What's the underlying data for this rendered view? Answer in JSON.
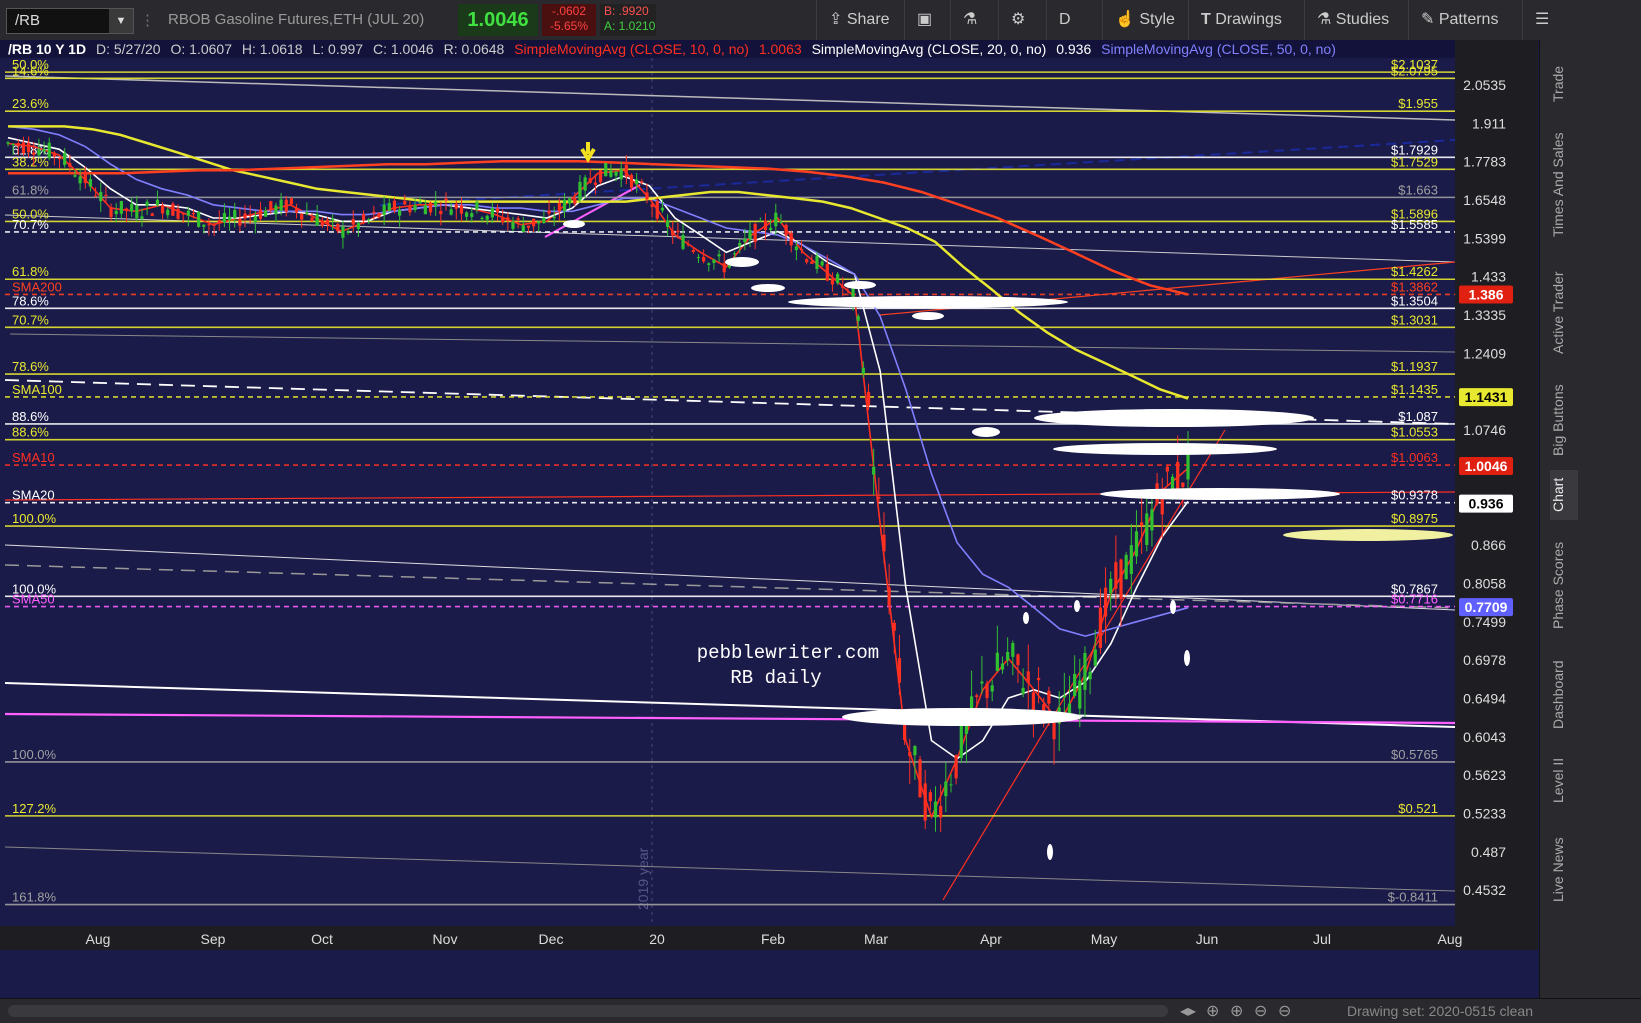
{
  "toolbar": {
    "symbol": "/RB",
    "description": "RBOB Gasoline Futures,ETH (JUL 20)",
    "last": "1.0046",
    "change": "-.0602",
    "change_pct": "-5.65%",
    "bid": "B: .9920",
    "ask": "A: 1.0210",
    "share_label": "Share",
    "period_label": "D",
    "style_label": "Style",
    "drawings_label": "Drawings",
    "studies_label": "Studies",
    "patterns_label": "Patterns"
  },
  "header": {
    "title": "/RB 10 Y 1D",
    "date": "D: 5/27/20",
    "open": "O: 1.0607",
    "high": "H: 1.0618",
    "low": "L: 0.997",
    "close": "C: 1.0046",
    "range": "R: 0.0648",
    "sma10_label": "SimpleMovingAvg (CLOSE, 10, 0, no)",
    "sma10_value": "1.0063",
    "sma20_label": "SimpleMovingAvg (CLOSE, 20, 0, no)",
    "sma20_value": "0.936",
    "sma50_label": "SimpleMovingAvg (CLOSE, 50, 0, no)"
  },
  "sidebar": {
    "tabs": [
      "Trade",
      "Times And Sales",
      "Active Trader",
      "Big Buttons",
      "Chart",
      "Phase Scores",
      "Dashboard",
      "Level II",
      "Live News"
    ]
  },
  "bottombar": {
    "drawing_set": "Drawing set: 2020-0515 clean"
  },
  "colors": {
    "background": "#1b1b4a",
    "fib": "#e8e830",
    "sma10": "#ff3020",
    "sma20": "#ffffff",
    "sma50": "#8080ff",
    "sma100": "#e8e830",
    "sma200": "#ff4020",
    "magenta": "#ff60ff",
    "up_candle": "#30c030",
    "down_candle": "#ff3020"
  },
  "chart_data": {
    "type": "candlestick",
    "title": "/RB 10 Y 1D",
    "watermark": [
      "pebblewriter.com",
      "RB daily"
    ],
    "year_label": "2019 year",
    "ylim": [
      0.435,
      2.12
    ],
    "y_ticks": [
      "2.0535",
      "1.911",
      "1.7783",
      "1.6548",
      "1.5399",
      "1.433",
      "1.3335",
      "1.2409",
      "1.0746",
      "0.866",
      "0.8058",
      "0.7499",
      "0.6978",
      "0.6494",
      "0.6043",
      "0.5623",
      "0.5233",
      "0.487",
      "0.4532"
    ],
    "x_ticks": [
      "Aug",
      "Sep",
      "Oct",
      "Nov",
      "Dec",
      "20",
      "Feb",
      "Mar",
      "Apr",
      "May",
      "Jun",
      "Jul",
      "Aug"
    ],
    "horizontal_levels": [
      {
        "label": "50.0%",
        "value": 2.1037,
        "right": "$2.1037",
        "color": "#e8e830"
      },
      {
        "label": "14.6%",
        "value": 2.0795,
        "right": "$2.0795",
        "color": "#e8e830"
      },
      {
        "label": "23.6%",
        "value": 1.955,
        "right": "$1.955",
        "color": "#e8e830"
      },
      {
        "label": "61.8%",
        "value": 1.7929,
        "right": "$1.7929",
        "color": "#ffffff"
      },
      {
        "label": "38.2%",
        "value": 1.7529,
        "right": "$1.7529",
        "color": "#e8e830"
      },
      {
        "label": "61.8%",
        "value": 1.663,
        "right": "$1.663",
        "color": "#a0a0a0"
      },
      {
        "label": "50.0%",
        "value": 1.5896,
        "right": "$1.5896",
        "color": "#e8e830"
      },
      {
        "label": "70.7%",
        "value": 1.5585,
        "right": "$1.5585",
        "color": "#ffffff"
      },
      {
        "label": "61.8%",
        "value": 1.4262,
        "right": "$1.4262",
        "color": "#e8e830"
      },
      {
        "label": "SMA200",
        "value": 1.3862,
        "right": "$1.3862",
        "color": "#ff4020"
      },
      {
        "label": "78.6%",
        "value": 1.3504,
        "right": "$1.3504",
        "color": "#ffffff"
      },
      {
        "label": "70.7%",
        "value": 1.3031,
        "right": "$1.3031",
        "color": "#e8e830"
      },
      {
        "label": "78.6%",
        "value": 1.1937,
        "right": "$1.1937",
        "color": "#e8e830"
      },
      {
        "label": "SMA100",
        "value": 1.1435,
        "right": "$1.1435",
        "color": "#e8e830"
      },
      {
        "label": "88.6%",
        "value": 1.087,
        "right": "$1.087",
        "color": "#ffffff"
      },
      {
        "label": "88.6%",
        "value": 1.0553,
        "right": "$1.0553",
        "color": "#e8e830"
      },
      {
        "label": "SMA10",
        "value": 1.0063,
        "right": "$1.0063",
        "color": "#ff3020"
      },
      {
        "label": "SMA20",
        "value": 0.9378,
        "right": "$0.9378",
        "color": "#ffffff"
      },
      {
        "label": "100.0%",
        "value": 0.8975,
        "right": "$0.8975",
        "color": "#e8e830"
      },
      {
        "label": "100.0%",
        "value": 0.7867,
        "right": "$0.7867",
        "color": "#ffffff"
      },
      {
        "label": "SMA50",
        "value": 0.7716,
        "right": "$0.7716",
        "color": "#ff60ff"
      },
      {
        "label": "100.0%",
        "value": 0.5765,
        "right": "$0.5765",
        "color": "#a0a0a0"
      },
      {
        "label": "127.2%",
        "value": 0.521,
        "right": "$0.521",
        "color": "#e8e830"
      },
      {
        "label": "161.8%",
        "value": 0.4411,
        "right": "$-0.8411",
        "color": "#a0a0a0"
      }
    ],
    "price_tags": [
      {
        "text": "1.386",
        "value": 1.386,
        "bg": "#e02010",
        "fg": "#ffffff"
      },
      {
        "text": "1.1431",
        "value": 1.1431,
        "bg": "#e8e830",
        "fg": "#000000"
      },
      {
        "text": "1.0046",
        "value": 1.0046,
        "bg": "#e02010",
        "fg": "#ffffff"
      },
      {
        "text": "0.936",
        "value": 0.936,
        "bg": "#ffffff",
        "fg": "#000000"
      },
      {
        "text": "0.7709",
        "value": 0.7709,
        "bg": "#6060ff",
        "fg": "#ffffff"
      }
    ],
    "series": [
      {
        "name": "SMA10",
        "color": "#ff3020",
        "values": [
          1.84,
          1.83,
          1.8,
          1.72,
          1.63,
          1.62,
          1.64,
          1.61,
          1.58,
          1.6,
          1.62,
          1.64,
          1.6,
          1.56,
          1.59,
          1.63,
          1.64,
          1.64,
          1.63,
          1.61,
          1.58,
          1.59,
          1.66,
          1.74,
          1.75,
          1.66,
          1.55,
          1.5,
          1.46,
          1.55,
          1.6,
          1.5,
          1.44,
          1.38,
          0.9,
          0.6,
          0.52,
          0.58,
          0.66,
          0.7,
          0.66,
          0.62,
          0.68,
          0.79,
          0.86,
          0.96,
          1.0
        ]
      },
      {
        "name": "SMA20",
        "color": "#ffffff",
        "values": [
          1.86,
          1.84,
          1.82,
          1.76,
          1.69,
          1.64,
          1.64,
          1.63,
          1.6,
          1.6,
          1.61,
          1.62,
          1.61,
          1.59,
          1.59,
          1.62,
          1.63,
          1.64,
          1.63,
          1.62,
          1.61,
          1.6,
          1.63,
          1.7,
          1.73,
          1.7,
          1.6,
          1.55,
          1.5,
          1.53,
          1.56,
          1.52,
          1.47,
          1.44,
          1.2,
          0.8,
          0.6,
          0.58,
          0.6,
          0.65,
          0.66,
          0.65,
          0.67,
          0.72,
          0.8,
          0.88,
          0.94
        ]
      },
      {
        "name": "SMA50",
        "color": "#8080ff",
        "values": [
          1.9,
          1.89,
          1.87,
          1.83,
          1.77,
          1.72,
          1.69,
          1.67,
          1.64,
          1.63,
          1.62,
          1.62,
          1.62,
          1.61,
          1.61,
          1.62,
          1.63,
          1.64,
          1.64,
          1.63,
          1.63,
          1.62,
          1.62,
          1.64,
          1.66,
          1.66,
          1.63,
          1.6,
          1.57,
          1.56,
          1.55,
          1.52,
          1.48,
          1.44,
          1.33,
          1.16,
          0.99,
          0.87,
          0.82,
          0.8,
          0.77,
          0.74,
          0.73,
          0.74,
          0.75,
          0.76,
          0.77
        ]
      },
      {
        "name": "SMA100",
        "color": "#e8e830",
        "values": [
          1.9,
          1.9,
          1.9,
          1.89,
          1.87,
          1.84,
          1.81,
          1.78,
          1.75,
          1.73,
          1.71,
          1.69,
          1.68,
          1.67,
          1.66,
          1.65,
          1.65,
          1.65,
          1.65,
          1.65,
          1.65,
          1.65,
          1.65,
          1.66,
          1.67,
          1.68,
          1.68,
          1.67,
          1.66,
          1.65,
          1.63,
          1.6,
          1.57,
          1.53,
          1.46,
          1.4,
          1.34,
          1.29,
          1.25,
          1.22,
          1.19,
          1.16,
          1.14
        ]
      },
      {
        "name": "SMA200",
        "color": "#ff4020",
        "values": [
          1.74,
          1.74,
          1.74,
          1.74,
          1.745,
          1.75,
          1.75,
          1.755,
          1.76,
          1.765,
          1.77,
          1.77,
          1.775,
          1.78,
          1.78,
          1.78,
          1.775,
          1.77,
          1.765,
          1.76,
          1.755,
          1.745,
          1.73,
          1.71,
          1.68,
          1.64,
          1.6,
          1.55,
          1.5,
          1.45,
          1.41,
          1.386
        ]
      }
    ]
  }
}
